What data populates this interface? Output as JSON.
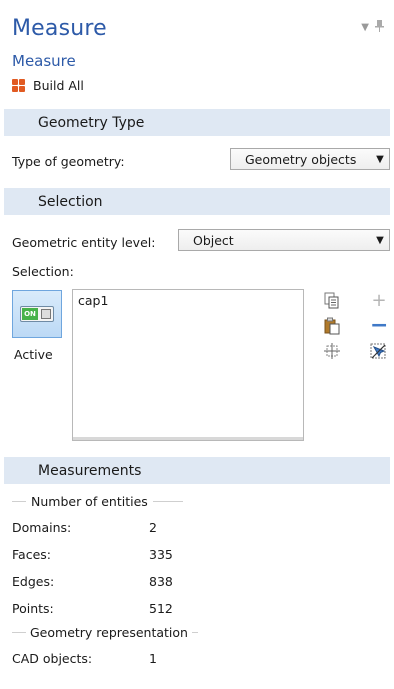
{
  "header": {
    "title": "Measure",
    "subtitle": "Measure",
    "build_all": "Build All"
  },
  "sections": {
    "geometry_type": "Geometry Type",
    "selection": "Selection",
    "measurements": "Measurements"
  },
  "geometry": {
    "label": "Type of geometry:",
    "value": "Geometry objects"
  },
  "selection": {
    "entity_level_label": "Geometric entity level:",
    "entity_level_value": "Object",
    "label": "Selection:",
    "toggle_text": "ON",
    "active_label": "Active",
    "items": [
      "cap1"
    ]
  },
  "measurements": {
    "entities_heading": "Number of entities",
    "rows": [
      {
        "label": "Domains:",
        "value": "2"
      },
      {
        "label": "Faces:",
        "value": "335"
      },
      {
        "label": "Edges:",
        "value": "838"
      },
      {
        "label": "Points:",
        "value": "512"
      }
    ],
    "representation_heading": "Geometry representation",
    "cad_label": "CAD objects:",
    "cad_value": "1"
  },
  "colors": {
    "accent": "#2d5aa8",
    "section_bg": "#dfe8f3",
    "toggle_on": "#48b24a",
    "remove": "#3f79c7"
  },
  "icons": [
    "pin-icon",
    "build-all-icon",
    "copy-icon",
    "paste-icon",
    "zoom-selection-icon",
    "add-icon",
    "remove-icon",
    "clear-selection-icon",
    "dropdown-arrow-icon"
  ]
}
